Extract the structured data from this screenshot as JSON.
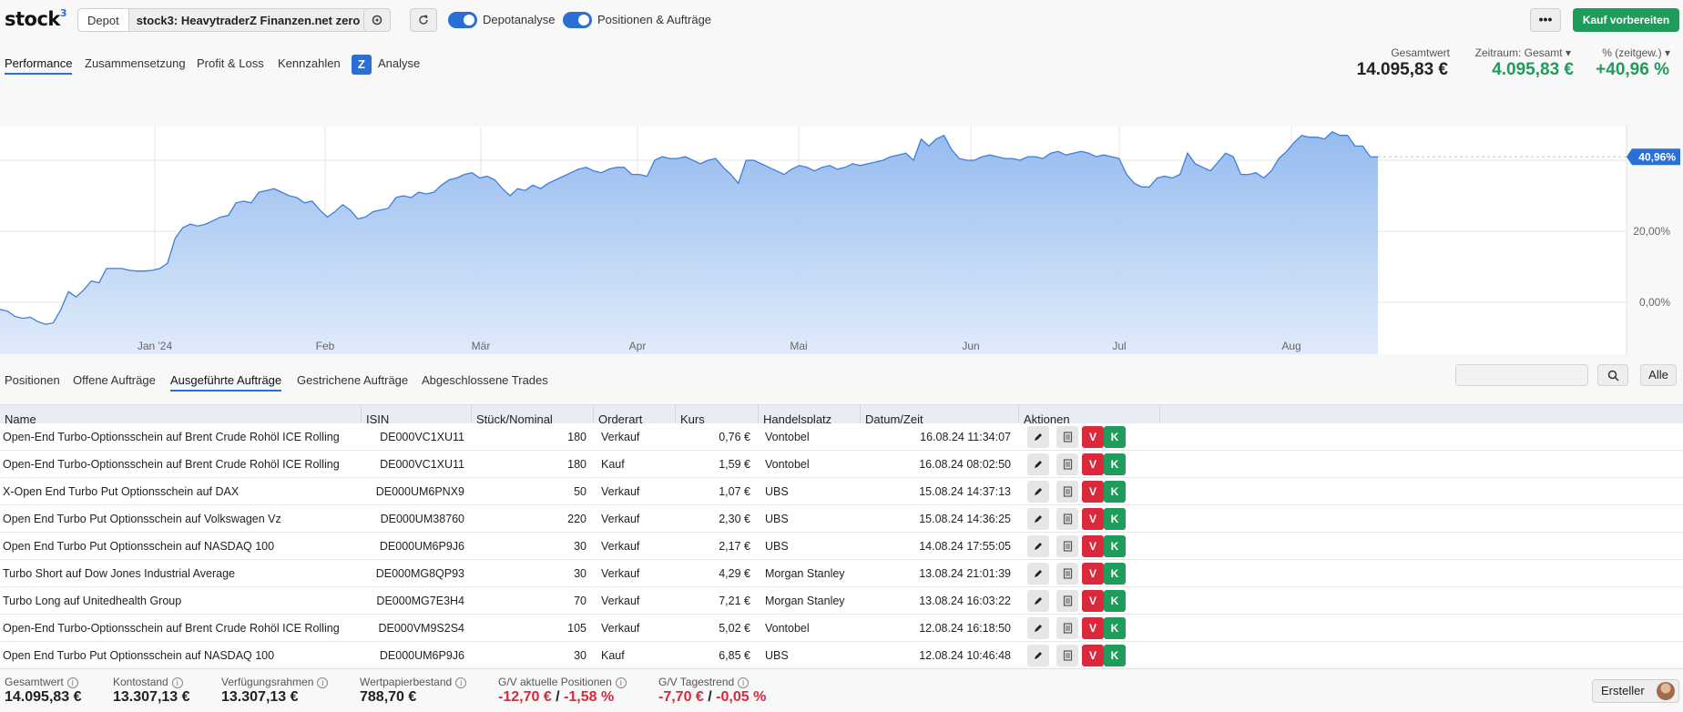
{
  "header": {
    "logo": "stock",
    "logo_sup": "3",
    "depot_label": "Depot",
    "depot_value": "stock3: HeavytraderZ Finanzen.net zero",
    "toggle1_label": "Depotanalyse",
    "toggle2_label": "Positionen & Aufträge",
    "more_label": "•••",
    "buy_label": "Kauf vorbereiten"
  },
  "tabs": [
    "Performance",
    "Zusammensetzung",
    "Profit & Loss",
    "Kennzahlen",
    "Analyse"
  ],
  "stats": {
    "gesamtwert_label": "Gesamtwert",
    "gesamtwert_value": "14.095,83 €",
    "zeitraum_label": "Zeitraum: Gesamt ▾",
    "zeitraum_value": "4.095,83 €",
    "pct_label": "% (zeitgew.) ▾",
    "pct_value": "+40,96 %"
  },
  "chart_data": {
    "type": "area",
    "x_ticks": [
      "Jan '24",
      "Feb",
      "Mär",
      "Apr",
      "Mai",
      "Jun",
      "Jul",
      "Aug"
    ],
    "y_ticks": [
      "20,00%",
      "0,00%"
    ],
    "y_range": [
      -7,
      50
    ],
    "current_label": "40,96%",
    "series": [
      {
        "values": [
          -2,
          -2.5,
          -4,
          -4.5,
          -4.2,
          -5.5,
          -6.2,
          -5.8,
          -2,
          3,
          1.5,
          3.5,
          6,
          5.5,
          9.5,
          9.5,
          9.5,
          9,
          8.8,
          8.8,
          9,
          9.5,
          11,
          18,
          21,
          22,
          21.5,
          22,
          23,
          24,
          24.5,
          28,
          28.5,
          28,
          31,
          31.5,
          32,
          31,
          30,
          29.5,
          28,
          28.5,
          26,
          24,
          25.5,
          27.5,
          26,
          23.5,
          24,
          25.5,
          26,
          26.5,
          29.5,
          30,
          29.5,
          31,
          30.5,
          31,
          33,
          34.5,
          35,
          36,
          36.5,
          35,
          35.5,
          34.5,
          32,
          30,
          32,
          31.5,
          33,
          32,
          33.5,
          34.5,
          35.5,
          36.5,
          37.5,
          38,
          37,
          36.5,
          37.5,
          38,
          38,
          36,
          36,
          35.5,
          40,
          41,
          40.5,
          40.5,
          41,
          40,
          39,
          40,
          40.5,
          38,
          36,
          33.5,
          40,
          40,
          39,
          38,
          37,
          36,
          37.5,
          38.5,
          38,
          37,
          38,
          38.5,
          37.5,
          38,
          39,
          38.5,
          39,
          39.5,
          40,
          41,
          41.5,
          42,
          40,
          46,
          44,
          46,
          47,
          43,
          40.5,
          40,
          40,
          41,
          41.5,
          41,
          40.5,
          40.5,
          40,
          41,
          41,
          40.5,
          42,
          42.5,
          41.5,
          42,
          42.5,
          42,
          41,
          41.5,
          41,
          40.5,
          36,
          33.5,
          32.5,
          32.5,
          35,
          35.5,
          35,
          36,
          42,
          39,
          38,
          37,
          39.5,
          42,
          41,
          36,
          36,
          36.5,
          35,
          37,
          40.5,
          42.5,
          45,
          47,
          46.5,
          46.5,
          46,
          48,
          47,
          47,
          44,
          44,
          41,
          40.96
        ]
      }
    ]
  },
  "order_tabs": [
    "Positionen",
    "Offene Aufträge",
    "Ausgeführte Aufträge",
    "Gestrichene Aufträge",
    "Abgeschlossene Trades"
  ],
  "search": {
    "placeholder": "",
    "alle_label": "Alle"
  },
  "table": {
    "columns": [
      "Name",
      "ISIN",
      "Stück/Nominal",
      "Orderart",
      "Kurs",
      "Handelsplatz",
      "Datum/Zeit",
      "Aktionen"
    ],
    "action_labels": {
      "v": "V",
      "k": "K"
    },
    "rows": [
      {
        "name": "Open-End Turbo-Optionsschein auf Brent Crude Rohöl ICE Rolling",
        "isin": "DE000VC1XU11",
        "qty": "180",
        "type": "Verkauf",
        "kurs": "0,76 €",
        "platz": "Vontobel",
        "datum": "16.08.24 11:34:07"
      },
      {
        "name": "Open-End Turbo-Optionsschein auf Brent Crude Rohöl ICE Rolling",
        "isin": "DE000VC1XU11",
        "qty": "180",
        "type": "Kauf",
        "kurs": "1,59 €",
        "platz": "Vontobel",
        "datum": "16.08.24 08:02:50"
      },
      {
        "name": "X-Open End Turbo Put Optionsschein auf DAX",
        "isin": "DE000UM6PNX9",
        "qty": "50",
        "type": "Verkauf",
        "kurs": "1,07 €",
        "platz": "UBS",
        "datum": "15.08.24 14:37:13"
      },
      {
        "name": "Open End Turbo Put Optionsschein auf Volkswagen Vz",
        "isin": "DE000UM38760",
        "qty": "220",
        "type": "Verkauf",
        "kurs": "2,30 €",
        "platz": "UBS",
        "datum": "15.08.24 14:36:25"
      },
      {
        "name": "Open End Turbo Put Optionsschein auf NASDAQ 100",
        "isin": "DE000UM6P9J6",
        "qty": "30",
        "type": "Verkauf",
        "kurs": "2,17 €",
        "platz": "UBS",
        "datum": "14.08.24 17:55:05"
      },
      {
        "name": "Turbo Short auf Dow Jones Industrial Average",
        "isin": "DE000MG8QP93",
        "qty": "30",
        "type": "Verkauf",
        "kurs": "4,29 €",
        "platz": "Morgan Stanley",
        "datum": "13.08.24 21:01:39"
      },
      {
        "name": "Turbo Long auf Unitedhealth Group",
        "isin": "DE000MG7E3H4",
        "qty": "70",
        "type": "Verkauf",
        "kurs": "7,21 €",
        "platz": "Morgan Stanley",
        "datum": "13.08.24 16:03:22"
      },
      {
        "name": "Open-End Turbo-Optionsschein auf Brent Crude Rohöl ICE Rolling",
        "isin": "DE000VM9S2S4",
        "qty": "105",
        "type": "Verkauf",
        "kurs": "5,02 €",
        "platz": "Vontobel",
        "datum": "12.08.24 16:18:50"
      },
      {
        "name": "Open End Turbo Put Optionsschein auf NASDAQ 100",
        "isin": "DE000UM6P9J6",
        "qty": "30",
        "type": "Kauf",
        "kurs": "6,85 €",
        "platz": "UBS",
        "datum": "12.08.24 10:46:48"
      }
    ]
  },
  "footer": {
    "gesamtwert_label": "Gesamtwert",
    "gesamtwert_value": "14.095,83 €",
    "kontostand_label": "Kontostand",
    "kontostand_value": "13.307,13 €",
    "verfuegung_label": "Verfügungsrahmen",
    "verfuegung_value": "13.307,13 €",
    "wp_label": "Wertpapierbestand",
    "wp_value": "788,70 €",
    "gv_pos_label": "G/V aktuelle Positionen",
    "gv_pos_abs": "-12,70 €",
    "gv_pos_pct": "-1,58 %",
    "gv_tag_label": "G/V Tagestrend",
    "gv_tag_abs": "-7,70 €",
    "gv_tag_pct": "-0,05 %",
    "separator": " / ",
    "info_glyph": "i",
    "ersteller_label": "Ersteller"
  },
  "colors": {
    "accent": "#2a6fd6",
    "buy": "#1f9b5b",
    "sell": "#d9293a",
    "chart_fill": "#a9c8f2"
  }
}
